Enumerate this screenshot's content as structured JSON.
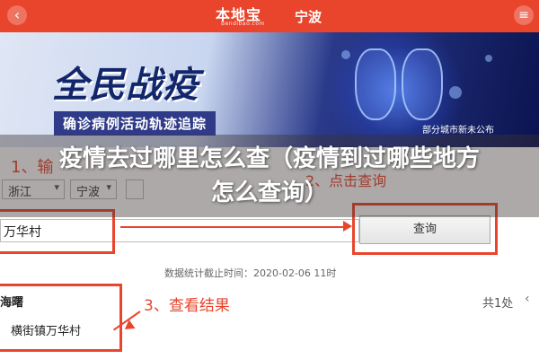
{
  "header": {
    "back_icon": "chevron-left-icon",
    "logo": "本地宝",
    "logo_sub": "Bendibao.com",
    "city": "宁波",
    "menu_icon": "menu-icon"
  },
  "banner": {
    "headline": "全民战疫",
    "tagline": "确诊病例活动轨迹追踪",
    "announce": "部分城市新未公布"
  },
  "steps": {
    "step1": "1、输",
    "step2": "2、点击查询",
    "step3": "3、查看结果"
  },
  "form": {
    "province": "浙江",
    "city": "宁波",
    "village": "万华村",
    "query_button": "查询"
  },
  "stats": "数据统计截止时间：2020-02-06 11时",
  "result": {
    "heading": "海曙",
    "value": "横街镇万华村",
    "count": "共1处"
  },
  "overlay_title": "疫情去过哪里怎么查（疫情到过哪些地方怎么查询）",
  "colors": {
    "accent": "#e8452c",
    "banner_dark": "#0b1450"
  }
}
